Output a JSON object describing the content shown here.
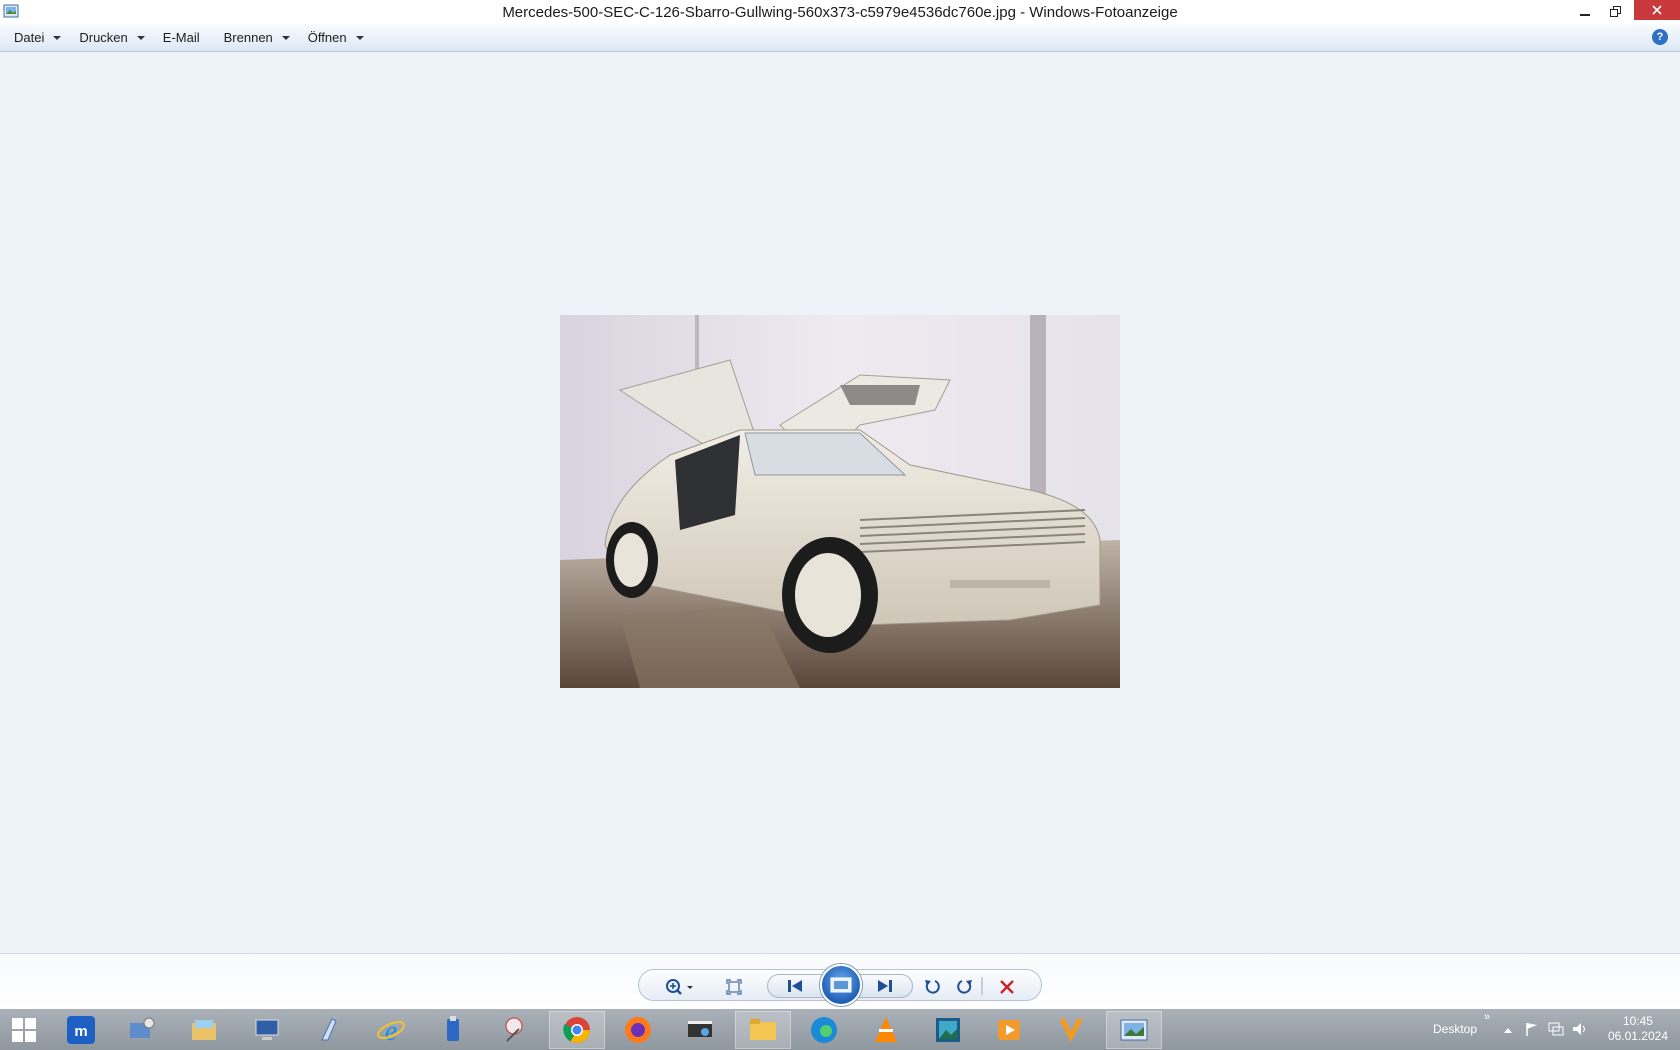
{
  "window": {
    "title": "Mercedes-500-SEC-C-126-Sbarro-Gullwing-560x373-c5979e4536dc760e.jpg - Windows-Fotoanzeige"
  },
  "menubar": {
    "items": [
      {
        "label": "Datei",
        "has_dropdown": true
      },
      {
        "label": "Drucken",
        "has_dropdown": true
      },
      {
        "label": "E-Mail",
        "has_dropdown": false
      },
      {
        "label": "Brennen",
        "has_dropdown": true
      },
      {
        "label": "Öffnen",
        "has_dropdown": true
      }
    ],
    "help_glyph": "?"
  },
  "controls": {
    "icons": [
      "zoom-icon",
      "actual-size-icon",
      "previous-icon",
      "slideshow-icon",
      "next-icon",
      "rotate-left-icon",
      "rotate-right-icon",
      "delete-icon"
    ]
  },
  "taskbar": {
    "apps": [
      "start",
      "maxthon",
      "system-config",
      "file-manager",
      "computer",
      "cleaner",
      "internet-explorer",
      "usb-tool",
      "snipping",
      "chrome",
      "firefox",
      "scanner",
      "explorer",
      "edge",
      "vlc",
      "photo-gallery",
      "media-player",
      "vegas",
      "photo-viewer"
    ],
    "desktop_label": "Desktop",
    "time": "10:45",
    "date": "06.01.2024"
  },
  "colors": {
    "viewer_bg": "#eef3fa",
    "close_button": "#c7393a",
    "delete_red": "#cc2222",
    "accent_blue": "#2f6fc4"
  }
}
